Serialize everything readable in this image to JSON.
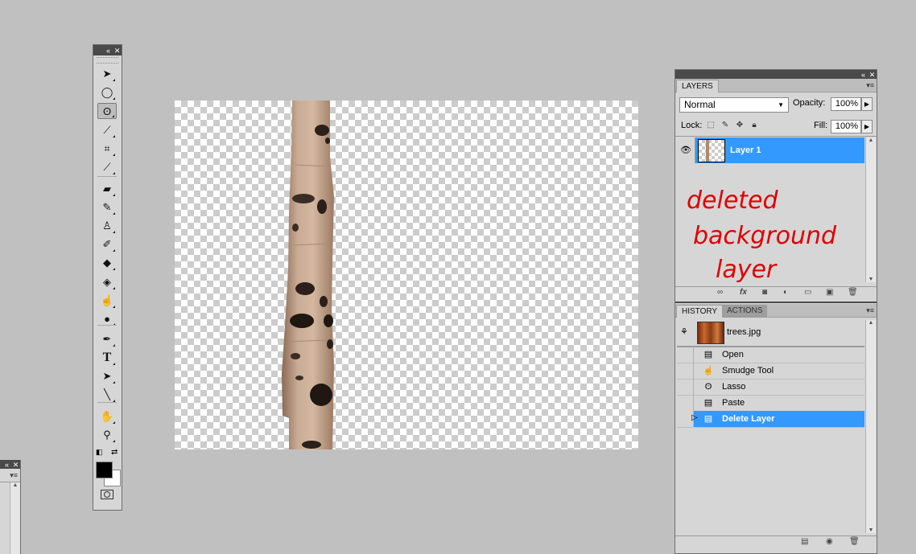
{
  "tools": {
    "items": [
      {
        "icon": "move-icon",
        "glyph": "➤"
      },
      {
        "icon": "elliptical-marquee-icon",
        "glyph": "◯"
      },
      {
        "icon": "lasso-icon",
        "glyph": "ʘ"
      },
      {
        "icon": "magic-wand-icon",
        "glyph": "⟋"
      },
      {
        "icon": "crop-icon",
        "glyph": "⌗"
      },
      {
        "icon": "eyedropper-icon",
        "glyph": "⟋"
      },
      {
        "icon": "healing-brush-icon",
        "glyph": "▰"
      },
      {
        "icon": "brush-icon",
        "glyph": "✎"
      },
      {
        "icon": "clone-stamp-icon",
        "glyph": "♙"
      },
      {
        "icon": "history-brush-icon",
        "glyph": "✐"
      },
      {
        "icon": "eraser-icon",
        "glyph": "◆"
      },
      {
        "icon": "paint-bucket-icon",
        "glyph": "◈"
      },
      {
        "icon": "smudge-icon",
        "glyph": "☝"
      },
      {
        "icon": "dodge-icon",
        "glyph": "●"
      },
      {
        "icon": "pen-icon",
        "glyph": "✒"
      },
      {
        "icon": "type-icon",
        "glyph": "T"
      },
      {
        "icon": "path-selection-icon",
        "glyph": "➤"
      },
      {
        "icon": "line-icon",
        "glyph": "╲"
      },
      {
        "icon": "hand-icon",
        "glyph": "✋"
      },
      {
        "icon": "zoom-icon",
        "glyph": "⚲"
      }
    ]
  },
  "layers_panel": {
    "tabs": [
      "LAYERS"
    ],
    "blend_mode": "Normal",
    "opacity_label": "Opacity:",
    "opacity_value": "100%",
    "lock_label": "Lock:",
    "fill_label": "Fill:",
    "fill_value": "100%",
    "layers": [
      {
        "name": "Layer 1",
        "visible": true,
        "selected": true
      }
    ],
    "annotation": [
      "deleted",
      "background",
      "layer"
    ],
    "annotation_color": "#e00000"
  },
  "history_panel": {
    "tabs": [
      "HISTORY",
      "ACTIONS"
    ],
    "snapshot": "trees.jpg",
    "steps": [
      {
        "label": "Open",
        "icon": "document-icon"
      },
      {
        "label": "Smudge Tool",
        "icon": "smudge-icon"
      },
      {
        "label": "Lasso",
        "icon": "lasso-icon"
      },
      {
        "label": "Paste",
        "icon": "document-icon"
      },
      {
        "label": "Delete Layer",
        "icon": "document-icon",
        "selected": true
      }
    ]
  },
  "colors": {
    "selection": "#3399ff",
    "workspace": "#c0c0c0",
    "panel": "#d6d6d6"
  }
}
